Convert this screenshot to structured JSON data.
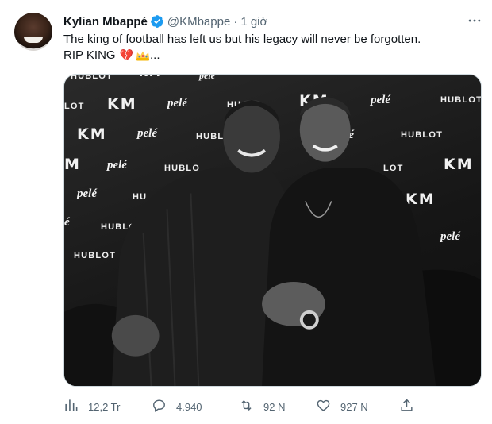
{
  "tweet": {
    "author_name": "Kylian Mbappé",
    "handle": "@KMbappe",
    "separator": "·",
    "time": "1 giờ",
    "text_line1": "The king of football has left us but his legacy will never be forgotten.",
    "text_line2": "RIP KING",
    "emoji_heart": "💔",
    "ellipsis": "..."
  },
  "photo": {
    "logos": {
      "hublot": "HUBLOT",
      "km": "KM",
      "pele": "pelé",
      "hu": "HU",
      "lot": "LOT",
      "hublo": "HUBLO",
      "hubl": "HUBL",
      "hublo2": "HUBLO",
      "m": "M",
      "e": "é"
    }
  },
  "actions": {
    "views": "12,2 Tr",
    "replies": "4.940",
    "retweets": "92 N",
    "likes": "927 N"
  },
  "icons": {
    "verified": "verified-badge-icon",
    "more": "more-options-icon",
    "views": "views-icon",
    "reply": "reply-icon",
    "retweet": "retweet-icon",
    "like": "like-icon",
    "share": "share-icon"
  },
  "colors": {
    "text": "#0f1419",
    "muted": "#536471",
    "verified": "#1d9bf0",
    "heart": "#e0245e"
  }
}
